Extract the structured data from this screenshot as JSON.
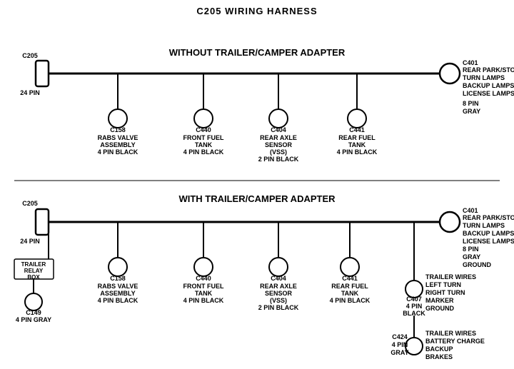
{
  "title": "C205 WIRING HARNESS",
  "section1": {
    "label": "WITHOUT TRAILER/CAMPER ADAPTER",
    "left_connector": {
      "name": "C205",
      "pins": "24 PIN"
    },
    "right_connector": {
      "name": "C401",
      "pins": "8 PIN",
      "color": "GRAY"
    },
    "right_labels": "REAR PARK/STOP\nTURN LAMPS\nBACKUP LAMPS\nLICENSE LAMPS",
    "connectors": [
      {
        "name": "C158",
        "desc": "RABS VALVE\nASSEMBLY\n4 PIN BLACK"
      },
      {
        "name": "C440",
        "desc": "FRONT FUEL\nTANK\n4 PIN BLACK"
      },
      {
        "name": "C404",
        "desc": "REAR AXLE\nSENSOR\n(VSS)\n2 PIN BLACK"
      },
      {
        "name": "C441",
        "desc": "REAR FUEL\nTANK\n4 PIN BLACK"
      }
    ]
  },
  "section2": {
    "label": "WITH TRAILER/CAMPER ADAPTER",
    "left_connector": {
      "name": "C205",
      "pins": "24 PIN"
    },
    "right_connector": {
      "name": "C401",
      "pins": "8 PIN",
      "color": "GRAY"
    },
    "right_labels1": "REAR PARK/STOP\nTURN LAMPS\nBACKUP LAMPS\nLICENSE LAMPS\nGROUND",
    "trailer_relay": {
      "name": "TRAILER\nRELAY\nBOX"
    },
    "c149": {
      "name": "C149",
      "desc": "4 PIN GRAY"
    },
    "connectors": [
      {
        "name": "C158",
        "desc": "RABS VALVE\nASSEMBLY\n4 PIN BLACK"
      },
      {
        "name": "C440",
        "desc": "FRONT FUEL\nTANK\n4 PIN BLACK"
      },
      {
        "name": "C404",
        "desc": "REAR AXLE\nSENSOR\n(VSS)\n2 PIN BLACK"
      },
      {
        "name": "C441",
        "desc": "REAR FUEL\nTANK\n4 PIN BLACK"
      }
    ],
    "c407": {
      "name": "C407",
      "desc": "4 PIN\nBLACK",
      "labels": "TRAILER WIRES\nLEFT TURN\nRIGHT TURN\nMARKER\nGROUND"
    },
    "c424": {
      "name": "C424",
      "desc": "4 PIN\nGRAY",
      "labels": "TRAILER WIRES\nBATTERY CHARGE\nBACKUP\nBRAKES"
    }
  }
}
